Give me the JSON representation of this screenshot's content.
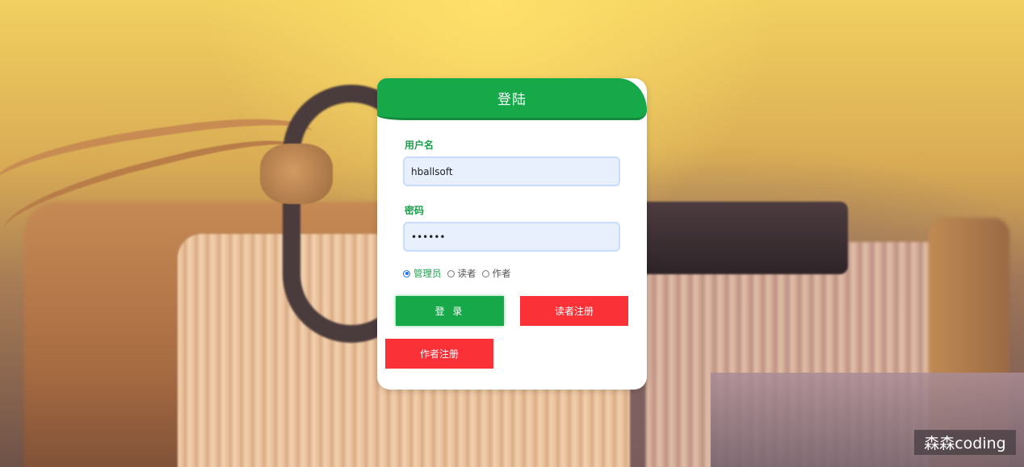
{
  "login": {
    "title": "登陆",
    "username_label": "用户名",
    "username_value": "hballsoft",
    "password_label": "密码",
    "password_value": "123456",
    "roles": [
      {
        "label": "管理员",
        "checked": true
      },
      {
        "label": "读者",
        "checked": false
      },
      {
        "label": "作者",
        "checked": false
      }
    ],
    "login_button": "登 录",
    "reader_register_button": "读者注册",
    "author_register_button": "作者注册"
  },
  "watermark": "森森coding",
  "colors": {
    "primary_green": "#17a84a",
    "register_red": "#fa3238",
    "input_bg": "#e8f0fe"
  }
}
